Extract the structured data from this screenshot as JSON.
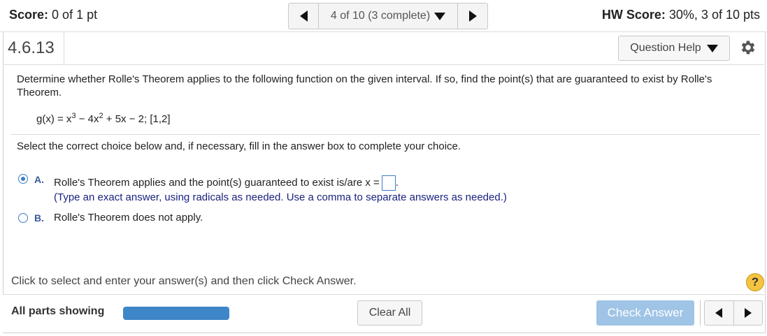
{
  "header": {
    "score_label": "Score:",
    "score_value": "0 of 1 pt",
    "pager_text": "4 of 10 (3 complete)",
    "hw_label": "HW Score:",
    "hw_value": "30%, 3 of 10 pts"
  },
  "question": {
    "number": "4.6.13",
    "help_label": "Question Help",
    "prompt": "Determine whether Rolle's Theorem applies to the following function on the given interval. If so, find the point(s) that are guaranteed to exist by Rolle's Theorem.",
    "formula": {
      "part1": "g(x) = x",
      "exp1": "3",
      "part2": " − 4x",
      "exp2": "2",
      "part3": " + 5x − 2; [1,2]"
    },
    "instruction": "Select the correct choice below and, if necessary, fill in the answer box to complete your choice.",
    "choices": [
      {
        "letter": "A.",
        "text": "Rolle's Theorem applies and the point(s) guaranteed to exist is/are x =",
        "suffix": ".",
        "selected": true
      },
      {
        "letter": "B.",
        "text": "Rolle's Theorem does not apply.",
        "selected": false
      }
    ],
    "hint": "(Type an exact answer, using radicals as needed. Use a comma to separate answers as needed.)",
    "answer_value": ""
  },
  "footer": {
    "instructions": "Click to select and enter your answer(s) and then click Check Answer.",
    "help_symbol": "?",
    "all_parts": "All parts showing",
    "progress": 1.0,
    "clear_all": "Clear All",
    "check_answer": "Check Answer"
  },
  "colors": {
    "accent": "#3a7ec6",
    "progress_fill": "#3f86c8",
    "check_button": "#9fc4e6",
    "help_badge": "#f5c342",
    "hint_text": "#1a237e"
  },
  "icons": [
    "prev-arrow-icon",
    "next-arrow-icon",
    "dropdown-caret-icon",
    "gear-icon",
    "help-icon"
  ]
}
